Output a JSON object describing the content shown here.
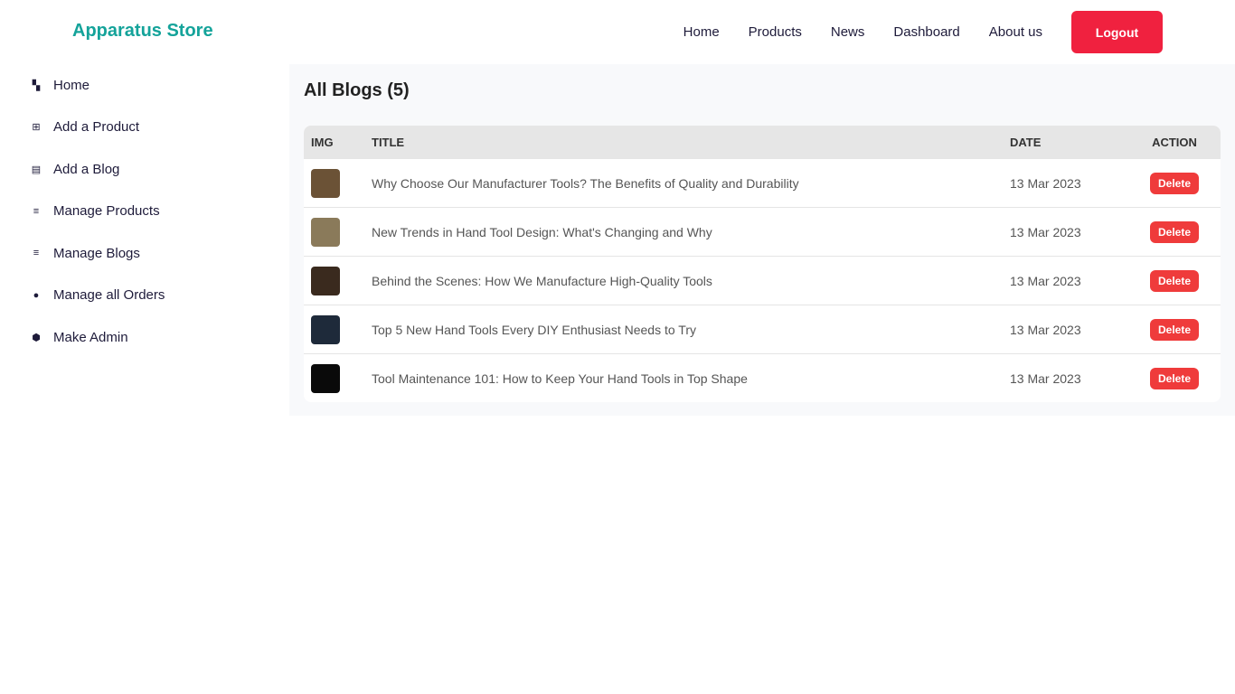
{
  "brand": "Apparatus Store",
  "nav": {
    "links": [
      "Home",
      "Products",
      "News",
      "Dashboard",
      "About us"
    ],
    "logout": "Logout"
  },
  "sidebar": {
    "items": [
      {
        "label": "Home",
        "icon": "dashboard-icon",
        "glyph": "▚"
      },
      {
        "label": "Add a Product",
        "icon": "add-box-icon",
        "glyph": "⊞"
      },
      {
        "label": "Add a Blog",
        "icon": "post-add-icon",
        "glyph": "▤"
      },
      {
        "label": "Manage Products",
        "icon": "manage-search-icon",
        "glyph": "≡"
      },
      {
        "label": "Manage Blogs",
        "icon": "manage-search-icon",
        "glyph": "≡"
      },
      {
        "label": "Manage all Orders",
        "icon": "manage-accounts-icon",
        "glyph": "●"
      },
      {
        "label": "Make Admin",
        "icon": "admin-shield-icon",
        "glyph": "⬢"
      }
    ]
  },
  "main": {
    "title": "All Blogs (5)",
    "headers": [
      "IMG",
      "TITLE",
      "DATE",
      "ACTION"
    ],
    "rows": [
      {
        "title": "Why Choose Our Manufacturer Tools? The Benefits of Quality and Durability",
        "date": "13 Mar 2023",
        "action": "Delete",
        "thumb": "#6b5236"
      },
      {
        "title": "New Trends in Hand Tool Design: What's Changing and Why",
        "date": "13 Mar 2023",
        "action": "Delete",
        "thumb": "#8a7a5a"
      },
      {
        "title": "Behind the Scenes: How We Manufacture High-Quality Tools",
        "date": "13 Mar 2023",
        "action": "Delete",
        "thumb": "#3a2a1e"
      },
      {
        "title": "Top 5 New Hand Tools Every DIY Enthusiast Needs to Try",
        "date": "13 Mar 2023",
        "action": "Delete",
        "thumb": "#1e2a3a"
      },
      {
        "title": "Tool Maintenance 101: How to Keep Your Hand Tools in Top Shape",
        "date": "13 Mar 2023",
        "action": "Delete",
        "thumb": "#0a0a0a"
      }
    ]
  }
}
